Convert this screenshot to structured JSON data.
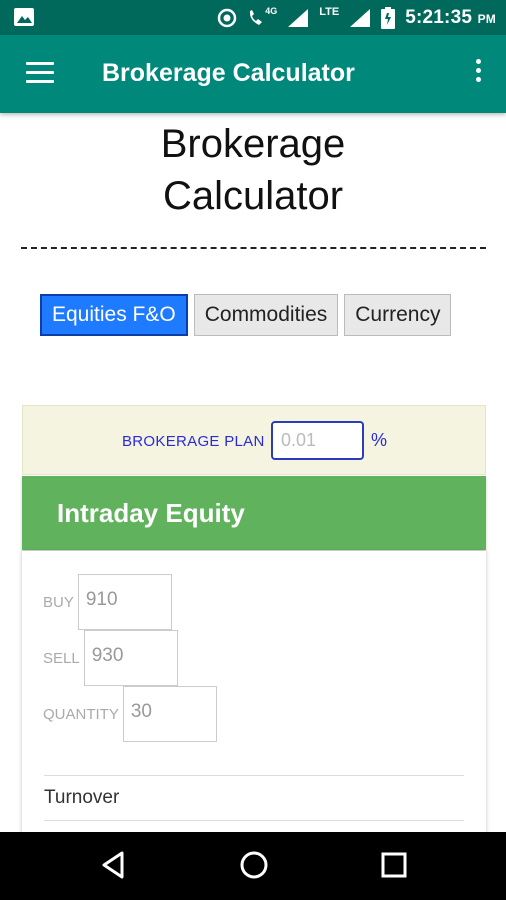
{
  "status_bar": {
    "network": "4G",
    "lte": "LTE",
    "time": "5:21:35",
    "ampm": "PM"
  },
  "app_bar": {
    "title": "Brokerage Calculator"
  },
  "page": {
    "heading_line1": "Brokerage",
    "heading_line2": "Calculator"
  },
  "tabs": [
    {
      "label": "Equities F&O",
      "active": true
    },
    {
      "label": "Commodities",
      "active": false
    },
    {
      "label": "Currency",
      "active": false
    }
  ],
  "brokerage_plan": {
    "label": "BROKERAGE PLAN",
    "placeholder": "0.01",
    "unit": "%"
  },
  "section": {
    "title": "Intraday Equity"
  },
  "fields": {
    "buy": {
      "label": "BUY",
      "value": "910"
    },
    "sell": {
      "label": "SELL",
      "value": "930"
    },
    "quantity": {
      "label": "QUANTITY",
      "value": "30"
    }
  },
  "results": {
    "turnover_label": "Turnover"
  },
  "colors": {
    "status_bar": "#00695c",
    "app_bar": "#00897b",
    "active_tab": "#1e7bff",
    "section_header": "#60b35c",
    "plan_bg": "#f4f4e1"
  }
}
